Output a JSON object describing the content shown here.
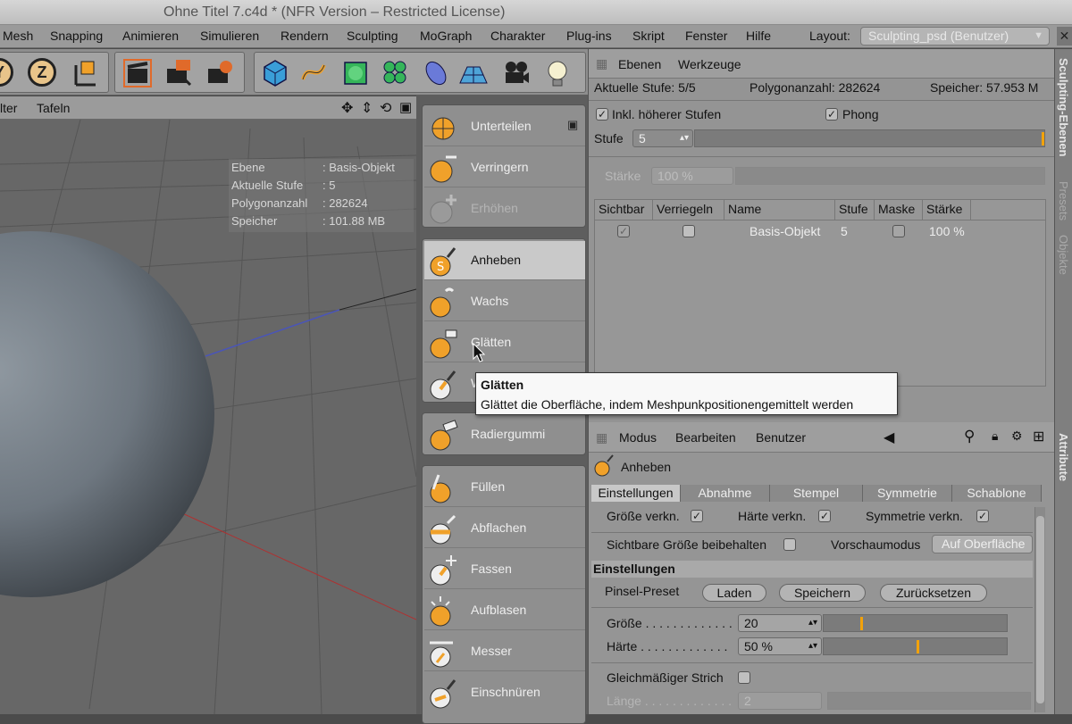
{
  "window": {
    "title": "Ohne Titel 7.c4d * (NFR Version – Restricted License)"
  },
  "menu": {
    "items": [
      "Mesh",
      "Snapping",
      "Animieren",
      "Simulieren",
      "Rendern",
      "Sculpting",
      "MoGraph",
      "Charakter",
      "Plug-ins",
      "Skript",
      "Fenster",
      "Hilfe"
    ],
    "layout_label": "Layout:",
    "layout_value": "Sculpting_psd (Benutzer)"
  },
  "toolbar": {
    "axis_y": "Y",
    "axis_z": "Z"
  },
  "viewport": {
    "menu": [
      "lter",
      "Tafeln"
    ],
    "info": [
      {
        "label": "Ebene",
        "value": ": Basis-Objekt"
      },
      {
        "label": "Aktuelle Stufe",
        "value": ": 5"
      },
      {
        "label": "Polygonanzahl",
        "value": ": 282624"
      },
      {
        "label": "Speicher",
        "value": ": 101.88 MB"
      }
    ]
  },
  "brushes": {
    "group1": [
      "Unterteilen",
      "Verringern",
      "Erhöhen"
    ],
    "group2": [
      "Anheben",
      "Wachs",
      "Glätten",
      "W"
    ],
    "group3": [
      "Radiergummi"
    ],
    "group4": [
      "Füllen",
      "Abflachen",
      "Fassen",
      "Aufblasen",
      "Messer",
      "Einschnüren"
    ]
  },
  "tooltip": {
    "title": "Glätten",
    "body": "Glättet die Oberfläche, indem Meshpunkpositionengemittelt werden"
  },
  "layers": {
    "menu": [
      "Ebenen",
      "Werkzeuge"
    ],
    "stats": {
      "level": "Aktuelle Stufe:  5/5",
      "polys": "Polygonanzahl:  282624",
      "memory": "Speicher:  57.953 M"
    },
    "incl_higher": "Inkl. höherer Stufen",
    "phong": "Phong",
    "stufe_label": "Stufe",
    "stufe_value": "5",
    "strength_label": "Stärke",
    "strength_value": "100 %",
    "columns": [
      "Sichtbar",
      "Verriegeln",
      "Name",
      "Stufe",
      "Maske",
      "Stärke"
    ],
    "row": {
      "name": "Basis-Objekt",
      "level": "5",
      "strength": "100 %"
    }
  },
  "attributes": {
    "menu": [
      "Modus",
      "Bearbeiten",
      "Benutzer"
    ],
    "tool": "Anheben",
    "tabs": [
      "Einstellungen",
      "Abnahme",
      "Stempel",
      "Symmetrie",
      "Schablone"
    ],
    "size_link": "Größe verkn.",
    "hard_link": "Härte verkn.",
    "sym_link": "Symmetrie verkn.",
    "keep_size": "Sichtbare Größe beibehalten",
    "preview_label": "Vorschaumodus",
    "preview_value": "Auf Oberfläche",
    "section": "Einstellungen",
    "preset_label": "Pinsel-Preset",
    "load": "Laden",
    "save": "Speichern",
    "reset": "Zurücksetzen",
    "size_label": "Größe . . . . . . . . . . . . .",
    "size_value": "20",
    "hardness_label": "Härte . . . . . . . . . . . . .",
    "hardness_value": "50 %",
    "even_stroke": "Gleichmäßiger Strich",
    "length_label": "Länge . . . . . . . . . . . . .",
    "length_value": "2"
  },
  "sidetabs": {
    "sculpt_layers": "Sculpting-Ebenen",
    "presets": "Presets",
    "objects": "Objekte",
    "attributes": "Attribute"
  },
  "colors": {
    "accent": "#f2a20a",
    "brush_orange": "#f0a12a"
  }
}
